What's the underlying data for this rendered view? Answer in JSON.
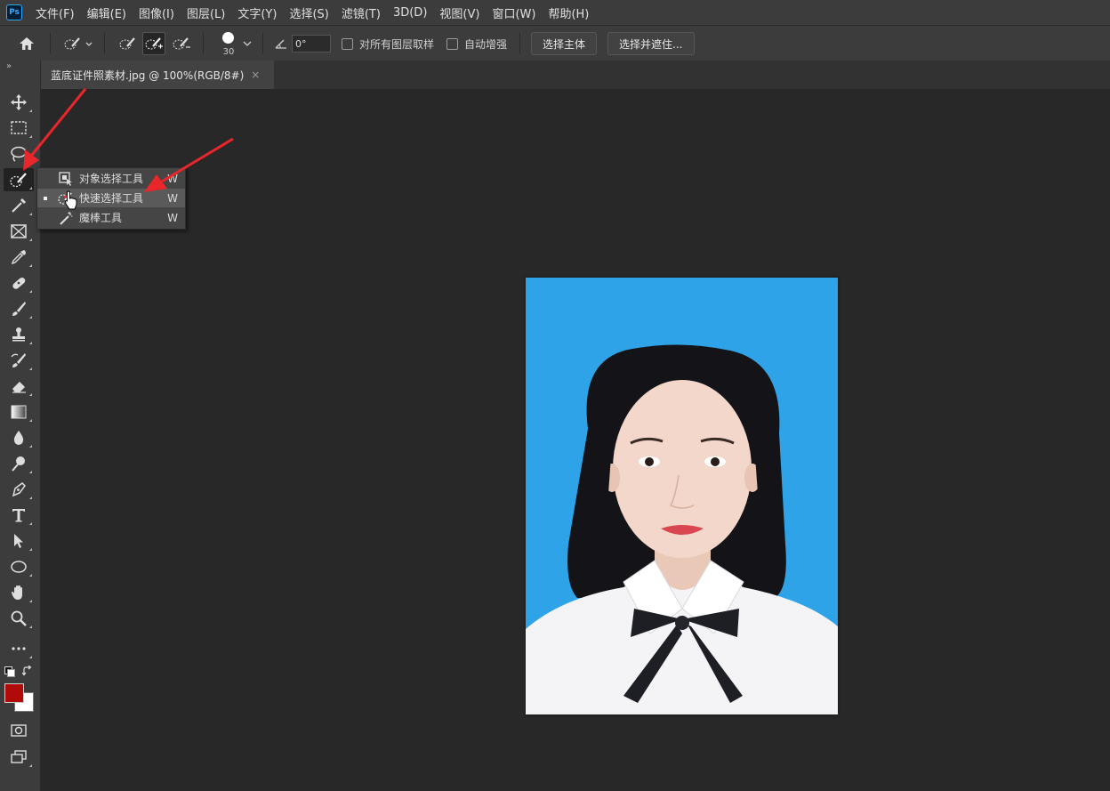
{
  "app": {
    "logo_text": "Ps"
  },
  "menu": [
    "文件(F)",
    "编辑(E)",
    "图像(I)",
    "图层(L)",
    "文字(Y)",
    "选择(S)",
    "滤镜(T)",
    "3D(D)",
    "视图(V)",
    "窗口(W)",
    "帮助(H)"
  ],
  "options": {
    "brush_size": "30",
    "angle_value": "0°",
    "sample_all_layers_label": "对所有图层取样",
    "auto_enhance_label": "自动增强",
    "select_subject_label": "选择主体",
    "select_and_mask_label": "选择并遮住..."
  },
  "tabs": [
    {
      "title": "蓝底证件照素材.jpg @ 100%(RGB/8#)",
      "close": "×"
    }
  ],
  "flyout": {
    "items": [
      {
        "label": "对象选择工具",
        "shortcut": "W",
        "icon": "object-selection-icon",
        "selected": false
      },
      {
        "label": "快速选择工具",
        "shortcut": "W",
        "icon": "quick-selection-icon",
        "selected": true
      },
      {
        "label": "魔棒工具",
        "shortcut": "W",
        "icon": "magic-wand-icon",
        "selected": false
      }
    ]
  },
  "colors": {
    "foreground": "#b10a0a",
    "background": "#ffffff",
    "photo_background": "#2ea3e8",
    "annotation_arrow": "#e8262b"
  },
  "canvas": {
    "document": "blue-background ID photo of a woman in white shirt with black bow tie"
  }
}
